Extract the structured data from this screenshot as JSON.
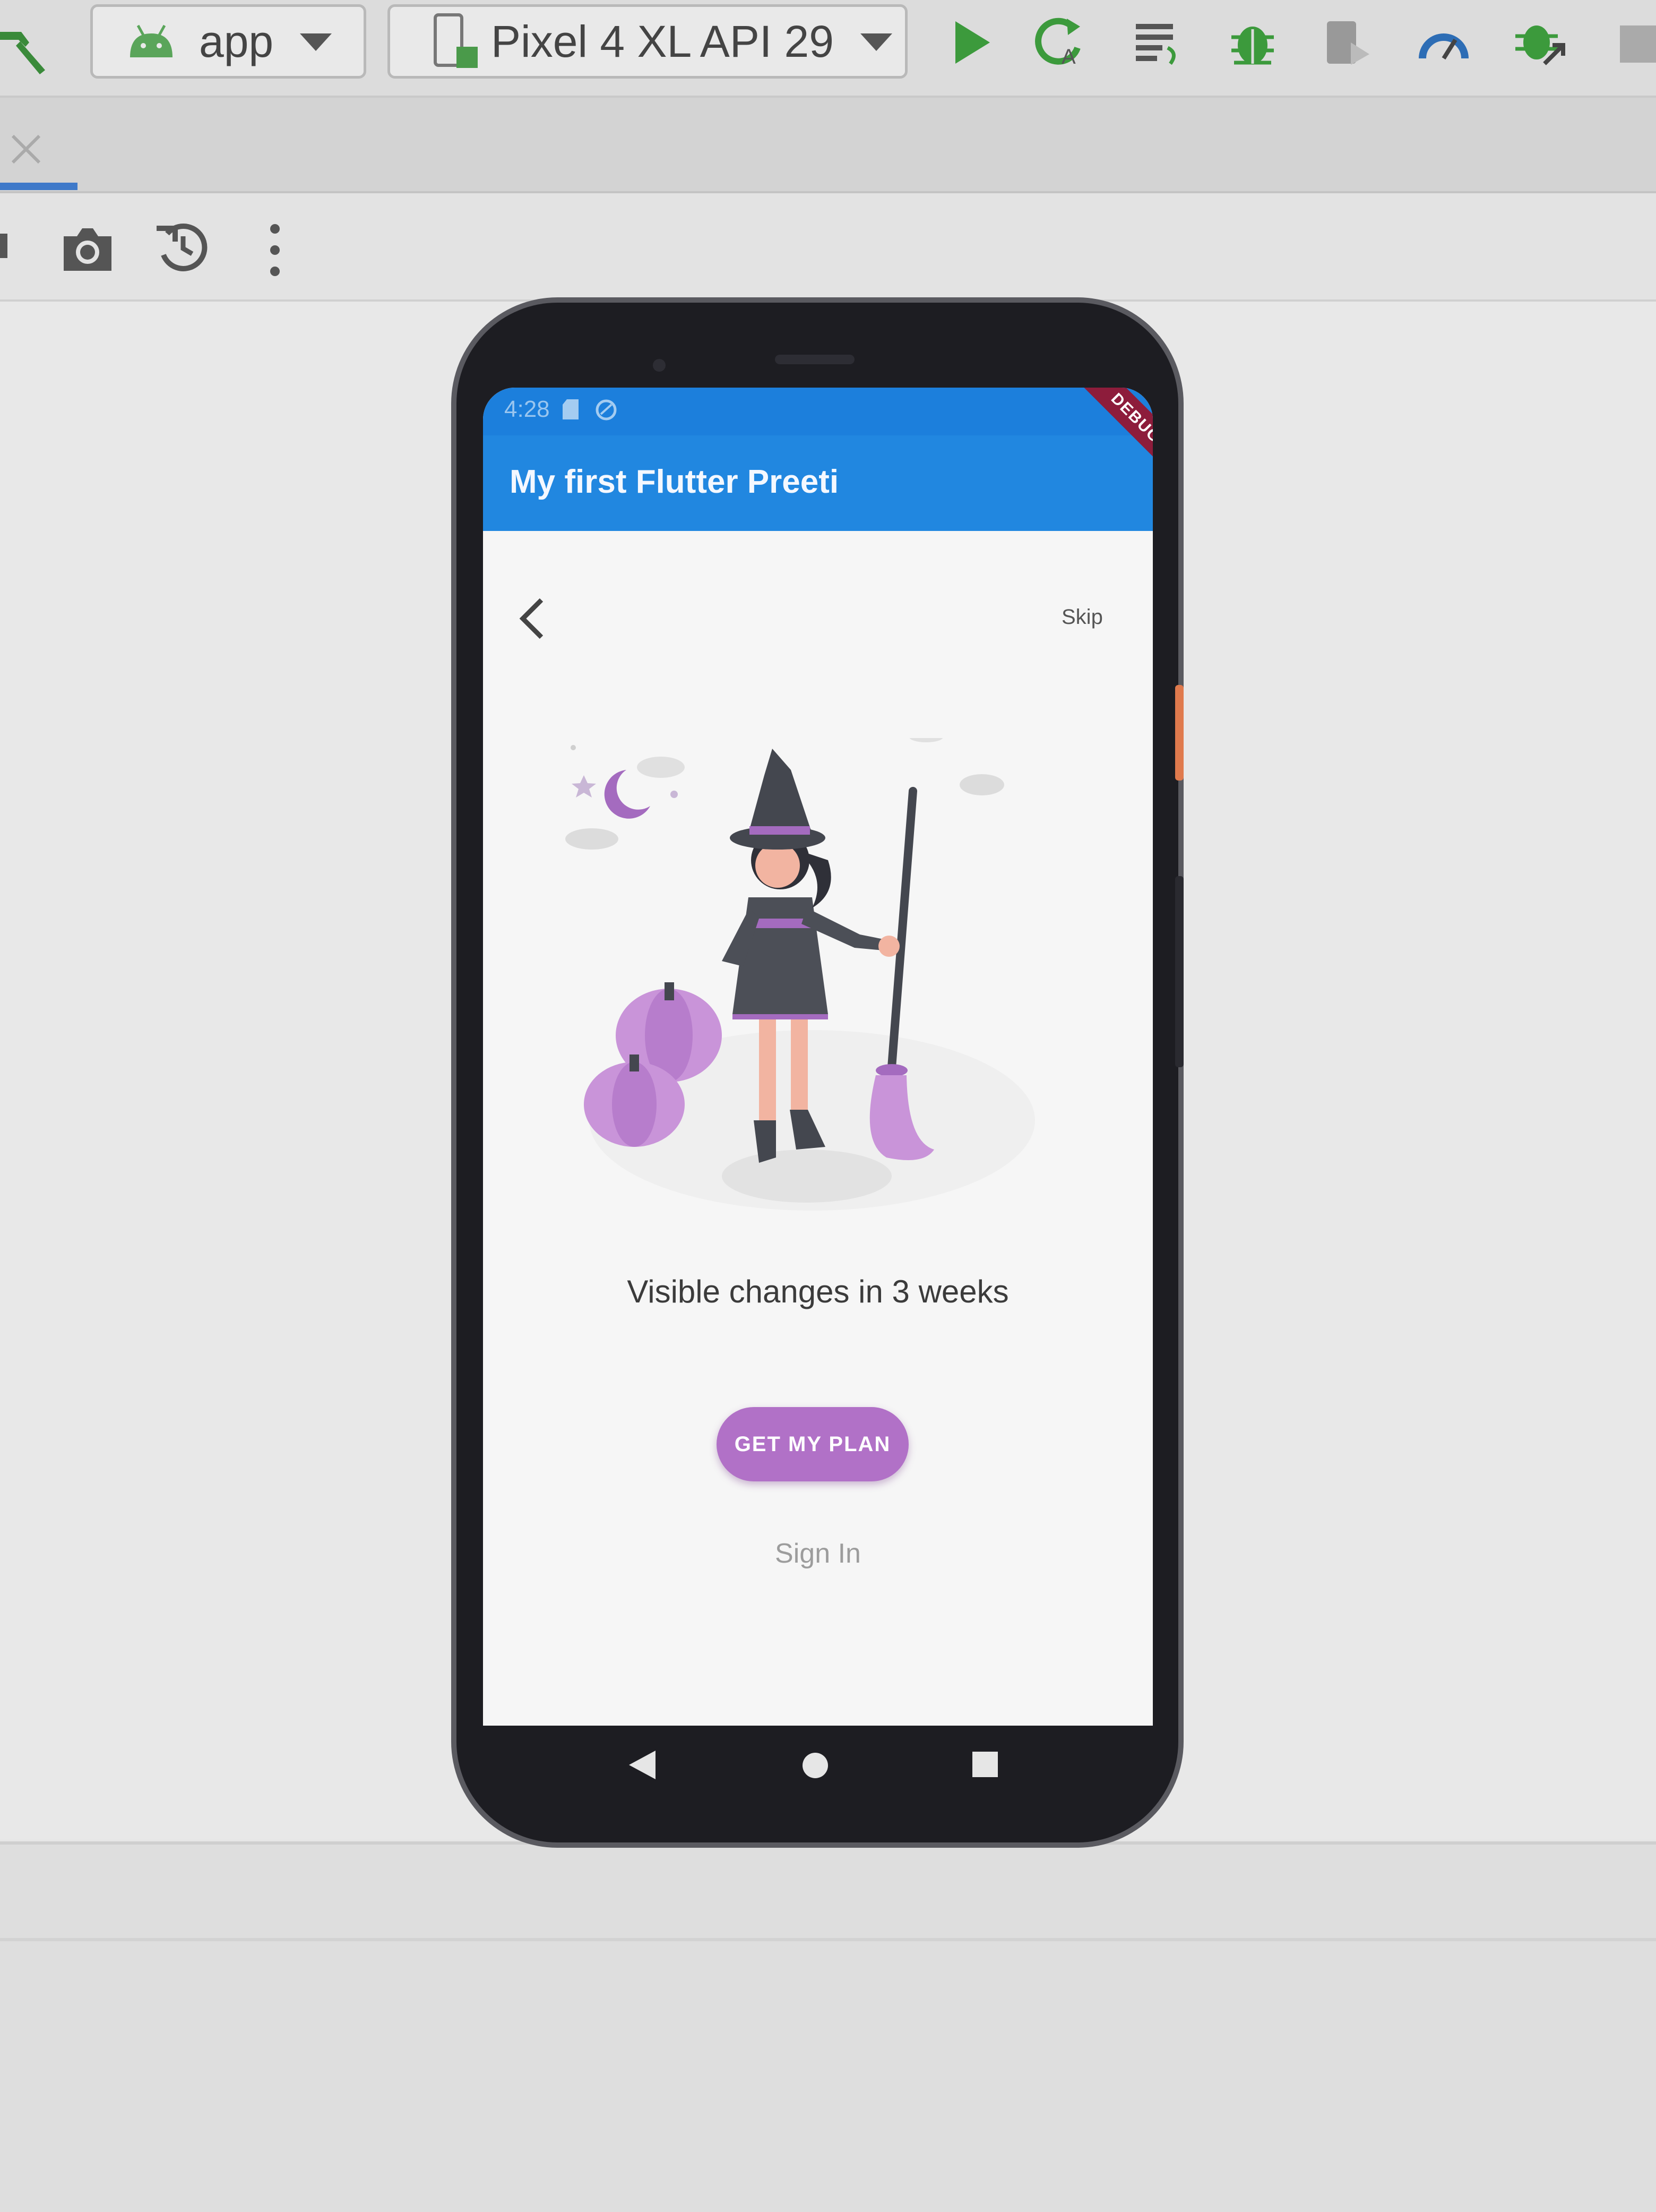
{
  "toolbar": {
    "config_label": "app",
    "device_label": "Pixel 4 XL API 29",
    "icons": [
      "hammer-icon",
      "android-icon",
      "device-icon",
      "run-icon",
      "apply-changes-icon",
      "apply-code-changes-icon",
      "debug-icon",
      "profile-icon",
      "profiler-icon",
      "attach-debugger-icon",
      "stop-icon"
    ]
  },
  "tab": {
    "close_icon": "close-icon"
  },
  "emulator_toolbar": {
    "icons": [
      "screenshot-icon",
      "restore-snapshot-icon",
      "more-icon"
    ]
  },
  "app": {
    "status_time": "4:28",
    "title": "My first Flutter Preeti",
    "debug_banner": "DEBUG",
    "skip_label": "Skip",
    "headline": "Visible changes in 3 weeks",
    "cta_label": "GET MY PLAN",
    "sign_in_label": "Sign In",
    "accent_color": "#b171c7",
    "appbar_color": "#2187e0"
  },
  "nav": {
    "icons": [
      "nav-back-icon",
      "nav-home-icon",
      "nav-recents-icon"
    ]
  }
}
